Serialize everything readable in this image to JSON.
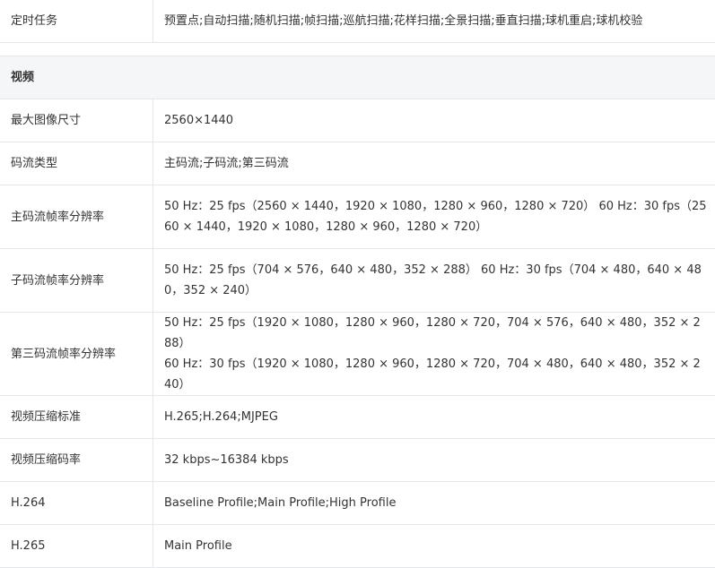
{
  "rows_before": [
    {
      "label": "定时任务",
      "value": "预置点;自动扫描;随机扫描;帧扫描;巡航扫描;花样扫描;全景扫描;垂直扫描;球机重启;球机校验"
    }
  ],
  "section": {
    "title": "视频"
  },
  "rows": [
    {
      "label": "最大图像尺寸",
      "value": "2560×1440"
    },
    {
      "label": "码流类型",
      "value": "主码流;子码流;第三码流"
    },
    {
      "label": "主码流帧率分辨率",
      "value": "50 Hz：25 fps（2560 × 1440，1920 × 1080，1280 × 960，1280 × 720） 60 Hz：30 fps（2560 × 1440，1920 × 1080，1280 × 960，1280 × 720）"
    },
    {
      "label": "子码流帧率分辨率",
      "value": "50 Hz：25 fps（704 × 576，640 × 480，352 × 288） 60 Hz：30 fps（704 × 480，640 × 480，352 × 240）"
    },
    {
      "label": "第三码流帧率分辨率",
      "value_lines": [
        "50 Hz：25 fps（1920 × 1080，1280 × 960，1280 × 720，704 × 576，640 × 480，352 × 288）",
        "60 Hz：30 fps（1920 × 1080，1280 × 960，1280 × 720，704 × 480，640 × 480，352 × 240）"
      ]
    },
    {
      "label": "视频压缩标准",
      "value": "H.265;H.264;MJPEG"
    },
    {
      "label": "视频压缩码率",
      "value": "32 kbps~16384 kbps"
    },
    {
      "label": "H.264",
      "value": "Baseline Profile;Main Profile;High Profile"
    },
    {
      "label": "H.265",
      "value": "Main Profile"
    }
  ]
}
